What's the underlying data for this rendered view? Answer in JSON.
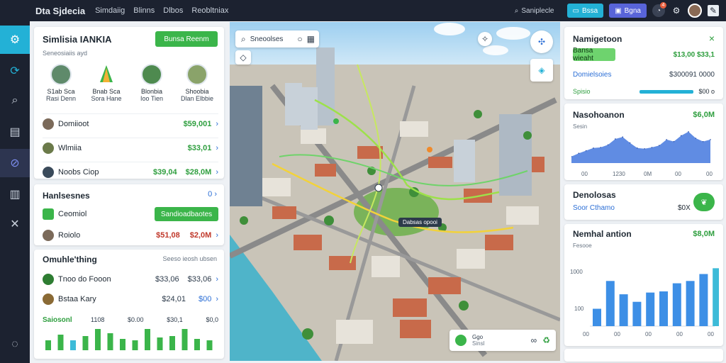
{
  "topbar": {
    "app_title": "Dta Sjdecia",
    "nav": [
      "Simdaiig",
      "Blinns",
      "Dlbos",
      "Reobltniax"
    ],
    "search_text": "Saniplecle",
    "btn_teal": "Bssa",
    "btn_violet": "Bgna",
    "notif_count": "4"
  },
  "left": {
    "sim_title": "Simlisia IANKIA",
    "sim_button": "Bunsa Reenm",
    "sim_subtitle": "Seneosiaiis ayd",
    "people": [
      {
        "name": "S1ab Sca",
        "role": "Rasi Denn"
      },
      {
        "name": "Bnab Sca",
        "role": "Sora Hane"
      },
      {
        "name": "Blonbia",
        "role": "Ioo Tien"
      },
      {
        "name": "Shoobia",
        "role": "Dlan Elbbie"
      }
    ],
    "rows": [
      {
        "label": "Domiioot",
        "value": "$59,001"
      },
      {
        "label": "Wlmiia",
        "value": "$33,01"
      },
      {
        "label": "Noobs Ciop",
        "value1": "$39,04",
        "value2": "$28,0M"
      }
    ],
    "hanks_title": "Hanlsesnes",
    "hanks_count": "0",
    "hanks_rows": [
      {
        "label": "Ceomiol",
        "button": "Sandioadbaotes"
      },
      {
        "label": "Roiolo",
        "value1": "$51,08",
        "value2": "$2,0M"
      }
    ],
    "list_title": "Omuhle'thing",
    "list_sub": "Seeso ieosh ubsen",
    "list_rows": [
      {
        "label": "Tnoo do Fooon",
        "value1": "$33,06",
        "value2": "$33,06"
      },
      {
        "label": "Bstaa Kary",
        "value1": "$24,01",
        "value2": "$00"
      }
    ],
    "mini_chart": {
      "label": "Saiosonl",
      "stats": [
        "1108",
        "$0.00",
        "$30,1",
        "$0,0"
      ]
    }
  },
  "map": {
    "search_label": "Sneoolses",
    "popup_label": "Dabsas opooi",
    "bottom_label": "Ggo",
    "bottom_sub": "Sinsl"
  },
  "right": {
    "nav_title": "Namigetoon",
    "nav_button": "Bansa wieaht",
    "nav_value": "$13,00 $33,1",
    "row1_label": "Domielsoies",
    "row1_value": "$300091 0000",
    "row2_label": "Spisio",
    "row2_value": "$00 o",
    "chart1_title": "Nasohoanon",
    "chart1_value": "$6,0M",
    "chart1_sub": "Sesin",
    "chart1_ticks": [
      "00",
      "1230",
      "0M",
      "00",
      "00"
    ],
    "onls_title": "Denolosas",
    "onls_sub": "Soor Cthamo",
    "onls_value": "$0X",
    "chart2_title": "Nemhal antion",
    "chart2_value": "$8,0M",
    "chart2_sub": "Fesooe",
    "chart2_y": [
      "1000",
      "100"
    ],
    "chart2_x": [
      "00",
      "00",
      "00",
      "00",
      "00"
    ]
  },
  "chart_data": [
    {
      "type": "area",
      "title": "Nasohoanon",
      "x": [
        0,
        1,
        2,
        3,
        4,
        5,
        6,
        7,
        8,
        9,
        10,
        11,
        12,
        13,
        14,
        15,
        16,
        17,
        18,
        19
      ],
      "values": [
        10,
        15,
        19,
        23,
        24,
        28,
        37,
        40,
        31,
        23,
        22,
        24,
        27,
        36,
        33,
        42,
        48,
        38,
        33,
        36
      ],
      "color": "#4f7fe0"
    },
    {
      "type": "bar",
      "title": "Nemhal antion",
      "values": [
        30,
        78,
        55,
        42,
        58,
        60,
        74,
        78,
        90,
        100,
        118
      ],
      "colors": [
        "#3d8fe6",
        "#3d8fe6",
        "#3d8fe6",
        "#3d8fe6",
        "#3d8fe6",
        "#3d8fe6",
        "#3d8fe6",
        "#3d8fe6",
        "#3d8fe6",
        "#3dbbd8",
        "#35c56a"
      ]
    },
    {
      "type": "bar",
      "title": "Saiosonl",
      "values": [
        14,
        22,
        14,
        20,
        30,
        24,
        16,
        14,
        30,
        18,
        20,
        30,
        16,
        14
      ],
      "colors": [
        "#3bb54a",
        "#3bb54a",
        "#3dbbd8",
        "#3bb54a",
        "#3bb54a",
        "#3bb54a",
        "#3bb54a",
        "#3bb54a",
        "#3bb54a",
        "#3bb54a",
        "#3bb54a",
        "#3bb54a",
        "#3bb54a",
        "#3bb54a"
      ]
    }
  ]
}
